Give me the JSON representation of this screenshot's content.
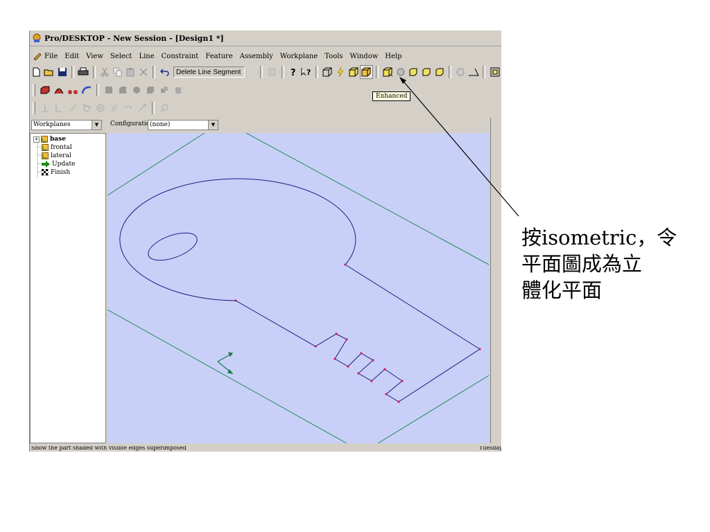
{
  "window": {
    "title": "Pro/DESKTOP - New Session - [Design1 *]"
  },
  "menubar": {
    "items": [
      "File",
      "Edit",
      "View",
      "Select",
      "Line",
      "Constraint",
      "Feature",
      "Assembly",
      "Workplane",
      "Tools",
      "Window",
      "Help"
    ]
  },
  "toolbar": {
    "command_box": "Delete Line Segment",
    "tooltip": "Enhanced",
    "active_button": "isometric-button"
  },
  "selectors": {
    "workplanes": "Workplanes",
    "configuration_label": "Configuration",
    "configuration_value": "(none)"
  },
  "tree": {
    "items": [
      "base",
      "frontal",
      "lateral",
      "Update",
      "Finish"
    ]
  },
  "statusbar": {
    "message": "Show the part shaded with visible edges superimposed",
    "day": "Tuesday"
  },
  "annotation": {
    "lines": [
      "按isometric，令",
      "平面圖成為立",
      "體化平面"
    ]
  },
  "colors": {
    "viewport_bg": "#c8d0f8",
    "workplane_lines": "#2a8a5a",
    "sketch_lines": "#1c1c7c",
    "sketch_points": "#cc1a66"
  }
}
